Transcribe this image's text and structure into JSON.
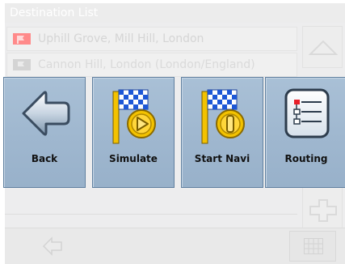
{
  "window": {
    "title": "Destination List"
  },
  "destinations": [
    {
      "text": "Uphill Grove, Mill Hill, London",
      "flag_color": "#ff8a8a"
    },
    {
      "text": "Cannon Hill, London (London/England)",
      "flag_color": "#d4d4d4"
    }
  ],
  "menu": {
    "back_label": "Back",
    "simulate_label": "Simulate",
    "start_navi_label": "Start Navi",
    "routing_label": "Routing"
  },
  "icons": {
    "back": "back-arrow-icon",
    "simulate": "checkered-flag-play-icon",
    "start_navi": "checkered-flag-start-icon",
    "routing": "route-list-icon",
    "scroll_up": "chevron-up-icon",
    "add": "plus-icon",
    "bottom_back": "left-arrow-icon",
    "bottom_keyboard": "keyboard-grid-icon"
  },
  "colors": {
    "button_face": "#a3bbd3",
    "button_border": "#5f7f9f",
    "flag_pole_yellow": "#f3c200",
    "checker_blue": "#1d57d6",
    "route_red": "#e8202a"
  }
}
